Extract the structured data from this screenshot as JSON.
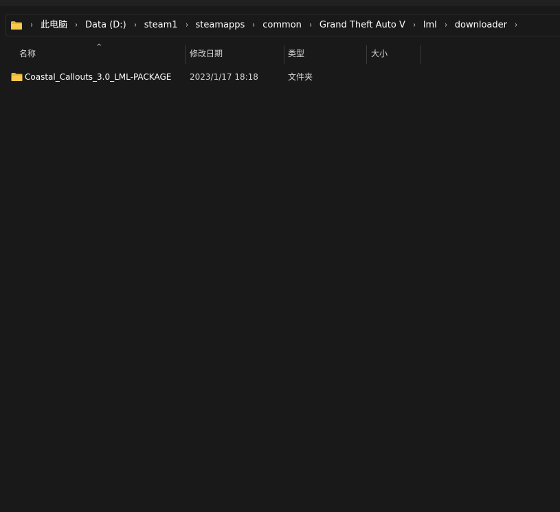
{
  "breadcrumb": {
    "root_icon": "folder-icon",
    "items": [
      {
        "label": "此电脑"
      },
      {
        "label": "Data (D:)"
      },
      {
        "label": "steam1"
      },
      {
        "label": "steamapps"
      },
      {
        "label": "common"
      },
      {
        "label": "Grand Theft Auto V"
      },
      {
        "label": "lml"
      },
      {
        "label": "downloader"
      }
    ],
    "separator": "›"
  },
  "columns": {
    "name": "名称",
    "modified": "修改日期",
    "type": "类型",
    "size": "大小",
    "sort_indicator": "^"
  },
  "files": [
    {
      "icon": "folder-icon",
      "name": "Coastal_Callouts_3.0_LML-PACKAGE",
      "modified": "2023/1/17 18:18",
      "type": "文件夹",
      "size": ""
    }
  ],
  "colors": {
    "background": "#191919",
    "folder": "#f8c94a",
    "text": "#ffffff",
    "secondary_text": "#d6d6d6"
  }
}
